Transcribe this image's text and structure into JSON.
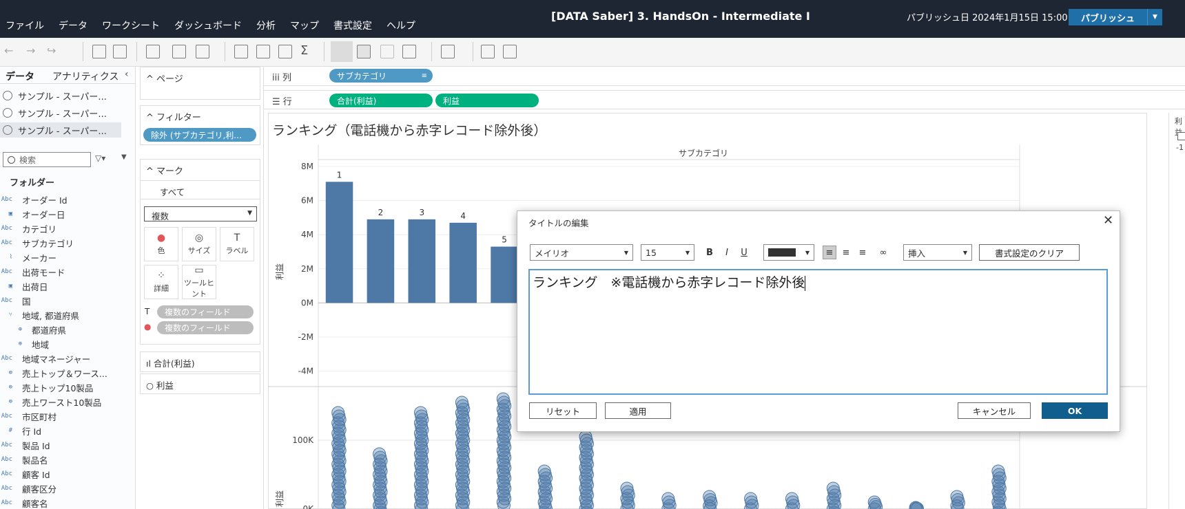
{
  "menubar": {
    "items": [
      "ファイル",
      "データ",
      "ワークシート",
      "ダッシュボード",
      "分析",
      "マップ",
      "書式設定",
      "ヘルプ"
    ],
    "workbook_title": "[DATA Saber] 3. HandsOn - Intermediate I",
    "publish_info": "パブリッシュ日 2024年1月15日 15:00",
    "publish_button": "パブリッシュ"
  },
  "data_pane": {
    "tabs": [
      "データ",
      "アナリティクス"
    ],
    "datasources": [
      "サンプル - スーパー...",
      "サンプル - スーパー...",
      "サンプル - スーパー..."
    ],
    "search_placeholder": "検索",
    "folder_header": "フォルダー",
    "fields": [
      {
        "type": "Abc",
        "name": "オーダー Id"
      },
      {
        "type": "cal",
        "name": "オーダー日"
      },
      {
        "type": "Abc",
        "name": "カテゴリ"
      },
      {
        "type": "Abc",
        "name": "サブカテゴリ"
      },
      {
        "type": "clip",
        "name": "メーカー"
      },
      {
        "type": "Abc",
        "name": "出荷モード"
      },
      {
        "type": "cal",
        "name": "出荷日"
      },
      {
        "type": "Abc",
        "name": "国"
      },
      {
        "type": "hier",
        "name": "地域, 都道府県"
      },
      {
        "type": "geo",
        "name": "都道府県",
        "child": true
      },
      {
        "type": "geo",
        "name": "地域",
        "child": true
      },
      {
        "type": "Abc",
        "name": "地域マネージャー"
      },
      {
        "type": "set",
        "name": "売上トップ＆ワース..."
      },
      {
        "type": "set",
        "name": "売上トップ10製品"
      },
      {
        "type": "set",
        "name": "売上ワースト10製品"
      },
      {
        "type": "Abc",
        "name": "市区町村"
      },
      {
        "type": "#",
        "name": "行 Id"
      },
      {
        "type": "Abc",
        "name": "製品 Id"
      },
      {
        "type": "Abc",
        "name": "製品名"
      },
      {
        "type": "Abc",
        "name": "顧客 Id"
      },
      {
        "type": "Abc",
        "name": "顧客区分"
      },
      {
        "type": "Abc",
        "name": "顧客名"
      }
    ]
  },
  "shelves": {
    "pages_label": "ページ",
    "filters_label": "フィルター",
    "filter_pill": "除外 (サブカテゴリ,利...",
    "marks_label": "マーク",
    "marks_all": "すべて",
    "mark_type": "複数",
    "mark_buttons": [
      "色",
      "サイズ",
      "ラベル",
      "詳細",
      "ツールヒント"
    ],
    "mark_fields": [
      "複数のフィールド",
      "複数のフィールド"
    ],
    "measure_sections": [
      "合計(利益)",
      "利益"
    ],
    "columns_label": "列",
    "rows_label": "行",
    "columns_pill": "サブカテゴリ",
    "rows_pills": [
      "合計(利益)",
      "利益"
    ]
  },
  "view": {
    "title": "ランキング（電話機から赤字レコード除外後）",
    "column_header": "サブカテゴリ",
    "legend_label": "利益",
    "legend_value": "-1"
  },
  "chart_data": [
    {
      "type": "bar",
      "title": "",
      "xlabel": "サブカテゴリ",
      "ylabel": "利益",
      "ylim": [
        -4500000,
        8000000
      ],
      "yticks": [
        "8M",
        "6M",
        "4M",
        "2M",
        "0M",
        "-2M",
        "-4M"
      ],
      "rank_labels": [
        "1",
        "2",
        "3",
        "4",
        "5"
      ],
      "values": [
        7100000,
        4900000,
        4900000,
        4700000,
        3300000
      ]
    },
    {
      "type": "scatter",
      "ylabel": "利益",
      "ylim": [
        -30000,
        170000
      ],
      "yticks": [
        "100K",
        "0K"
      ],
      "columns": [
        {
          "top": 140000,
          "bottom": 0
        },
        {
          "top": 80000,
          "bottom": -5000
        },
        {
          "top": 140000,
          "bottom": 0
        },
        {
          "top": 155000,
          "bottom": 0
        },
        {
          "top": 160000,
          "bottom": 5000
        },
        {
          "top": 55000,
          "bottom": -5000
        },
        {
          "top": 105000,
          "bottom": -5000
        },
        {
          "top": 30000,
          "bottom": 0
        },
        {
          "top": 15000,
          "bottom": 0
        },
        {
          "top": 18000,
          "bottom": 0
        },
        {
          "top": 15000,
          "bottom": 0
        },
        {
          "top": 15000,
          "bottom": 0
        },
        {
          "top": 30000,
          "bottom": -5000
        },
        {
          "top": 10000,
          "bottom": 0
        },
        {
          "top": 2000,
          "bottom": 0
        },
        {
          "top": 18000,
          "bottom": 0
        },
        {
          "top": 55000,
          "bottom": -10000
        }
      ]
    }
  ],
  "dialog": {
    "title": "タイトルの編集",
    "font": "メイリオ",
    "size": "15",
    "format_buttons": [
      "B",
      "I",
      "U"
    ],
    "insert_label": "挿入",
    "clear_format": "書式設定のクリア",
    "editor_text": "ランキング　※電話機から赤字レコード除外後",
    "reset": "リセット",
    "apply": "適用",
    "cancel": "キャンセル",
    "ok": "OK"
  },
  "colors": {
    "bar": "#4e79a7",
    "accent": "#1f6fa8",
    "pill_blue": "#4e9ac4",
    "pill_green": "#00b180",
    "topbar": "#1f2633"
  }
}
